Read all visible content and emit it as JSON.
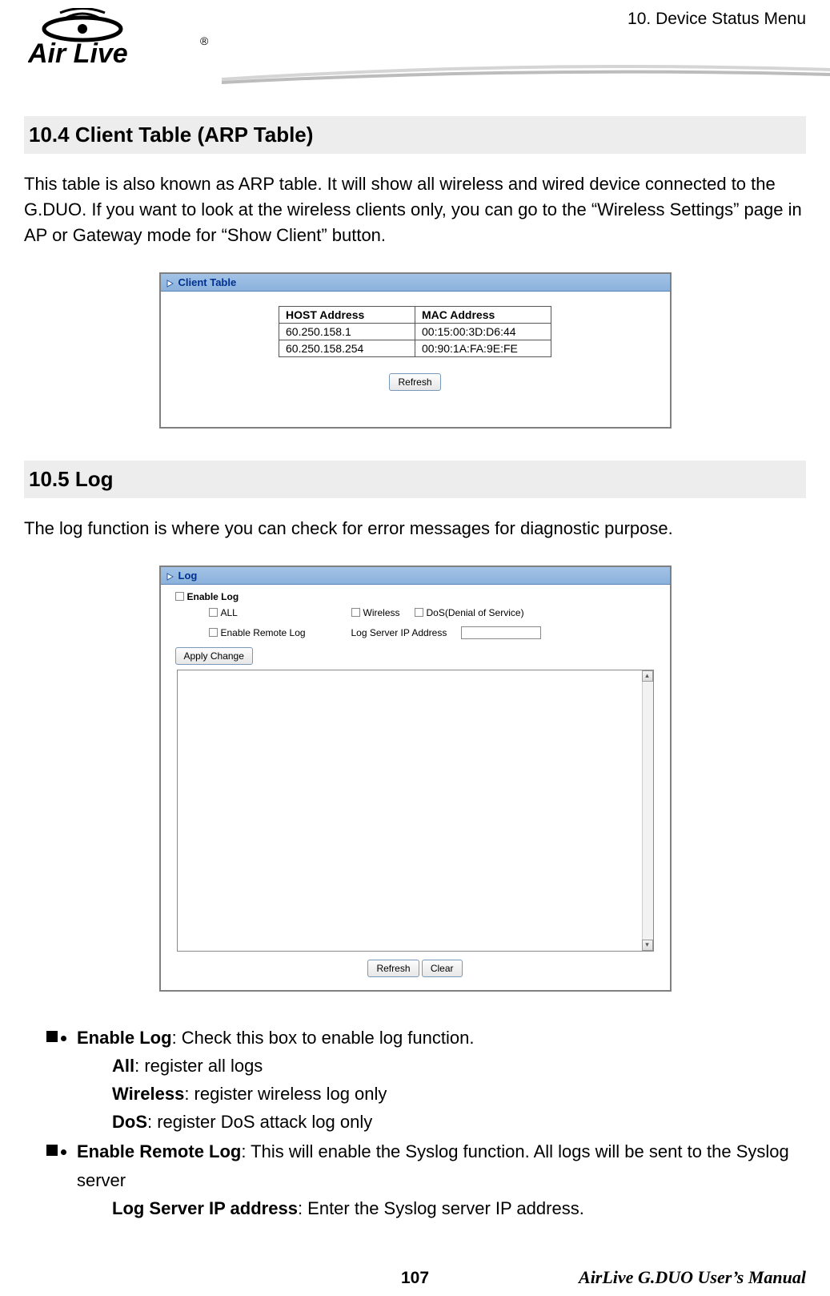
{
  "header": {
    "chapter_label": "10.  Device  Status  Menu",
    "logo_text": "Air Live",
    "logo_reg_mark": "®"
  },
  "section104": {
    "heading": "10.4 Client  Table  (ARP  Table)",
    "paragraph": "This table is also known as ARP table.   It will show all wireless and wired device connected to the G.DUO.   If you want to look at the wireless clients only, you can go to the “Wireless Settings” page in AP or Gateway mode for “Show Client” button.",
    "panel_title": "Client Table",
    "col_host": "HOST Address",
    "col_mac": "MAC Address",
    "rows": [
      {
        "host": "60.250.158.1",
        "mac": "00:15:00:3D:D6:44"
      },
      {
        "host": "60.250.158.254",
        "mac": "00:90:1A:FA:9E:FE"
      }
    ],
    "refresh_btn": "Refresh"
  },
  "section105": {
    "heading": "10.5 Log",
    "paragraph": "The log function is where you can check for error messages for diagnostic purpose.",
    "panel_title": "Log",
    "enable_log": "Enable Log",
    "cb_all": "ALL",
    "cb_wireless": "Wireless",
    "cb_dos": "DoS(Denial of Service)",
    "cb_remote": "Enable Remote Log",
    "ip_label": "Log Server IP Address",
    "apply_btn": "Apply Change",
    "refresh_btn": "Refresh",
    "clear_btn": "Clear"
  },
  "bullets": {
    "enable_log_k": "Enable Log",
    "enable_log_v": ":   Check this box to enable log function.",
    "all_k": "All",
    "all_v": ": register all logs",
    "wireless_k": "Wireless",
    "wireless_v": ": register wireless log only",
    "dos_k": "DoS",
    "dos_v": ": register DoS attack log only",
    "remote_k": "Enable Remote Log",
    "remote_v": ": This will enable the Syslog function.   All logs will be sent to the Syslog server",
    "ip_k": "Log Server IP address",
    "ip_v": ":   Enter the Syslog server IP address."
  },
  "footer": {
    "page": "107",
    "manual": "AirLive  G.DUO  User’s  Manual"
  }
}
